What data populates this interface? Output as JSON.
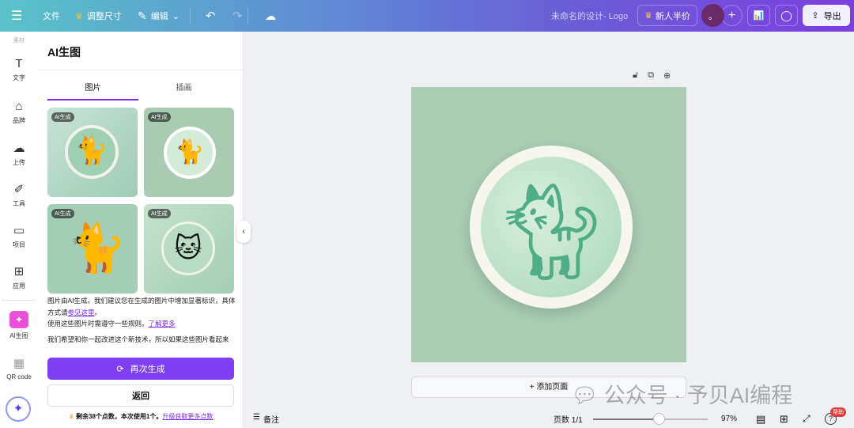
{
  "topbar": {
    "menu_icon": "hamburger-icon",
    "file": "文件",
    "resize": "调整尺寸",
    "edit": "编辑",
    "title": "未命名的设计- Logo",
    "promo": "新人半价",
    "avatar": "。",
    "export": "导出"
  },
  "rail": {
    "top_label": "素材",
    "items": [
      {
        "label": "文字",
        "icon": "T"
      },
      {
        "label": "品牌",
        "icon": "brand-icon"
      },
      {
        "label": "上传",
        "icon": "upload-icon"
      },
      {
        "label": "工具",
        "icon": "tools-icon"
      },
      {
        "label": "项目",
        "icon": "folder-icon"
      },
      {
        "label": "应用",
        "icon": "apps-icon"
      },
      {
        "label": "AI生图",
        "icon": "ai-image-icon"
      },
      {
        "label": "QR code",
        "icon": "qr-icon"
      }
    ]
  },
  "panel": {
    "title": "AI生图",
    "tabs": [
      "图片",
      "插画"
    ],
    "active_tab": 0,
    "badge": "AI生成",
    "note1_a": "图片由AI生成。我们建议您在生成的图片中增加显著标识，具体方式请",
    "note1_link": "参见这里",
    "note1_b": "。",
    "note2": "使用这些图片时需遵守一些规则。",
    "note2_link": "了解更多",
    "note3": "我们希望和你一起改进这个新技术，所以如果这些图片看起来",
    "regenerate": "再次生成",
    "back": "返回",
    "credits": "剩余38个点数，本次使用1个。",
    "credits_link": "升级获取更多点数"
  },
  "canvas": {
    "add_page": "+ 添加页面",
    "watermark": "公众号 · 予贝AI编程"
  },
  "bottom": {
    "notes": "备注",
    "pages": "页数 1/1",
    "zoom_percent": 97,
    "zoom_label": "97%",
    "help_badge": "帮助"
  }
}
